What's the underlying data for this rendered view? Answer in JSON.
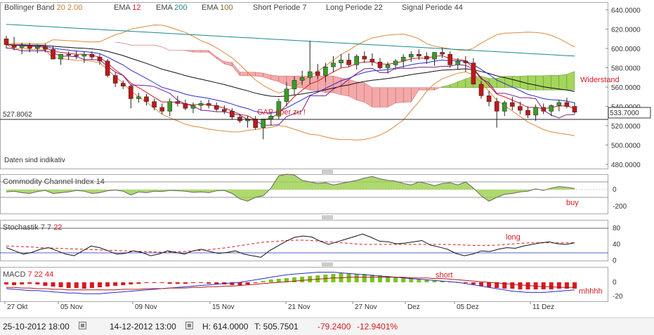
{
  "header": {
    "items": [
      {
        "name": "Bollinger Band",
        "params": "20",
        "params2": "2.00",
        "color": "#c97a2a"
      },
      {
        "name": "EMA",
        "params": "12",
        "color": "#d71920"
      },
      {
        "name": "EMA",
        "params": "200",
        "color": "#1a8a8a"
      },
      {
        "name": "EMA",
        "params": "100",
        "color": "#8a6a2a"
      },
      {
        "name": "Short Periode",
        "params": "7",
        "color": "#444444"
      },
      {
        "name": "Long Periode",
        "params": "22",
        "color": "#444444"
      },
      {
        "name": "Signal Periode",
        "params": "44",
        "color": "#444444"
      }
    ]
  },
  "main": {
    "y_ticks": [
      "640.0000",
      "620.0000",
      "600.0000",
      "580.0000",
      "560.0000",
      "540.0000",
      "520.0000",
      "500.0000",
      "480.0000"
    ],
    "left_marker": "527.8062",
    "last_price": "533.7000",
    "note": "Daten sind indikativ",
    "ann_gap": "GAP aber zu !",
    "ann_widerstand": "Widerstand"
  },
  "cci": {
    "title": "Commodity Channel Index",
    "param": "14",
    "ticks": [
      "0",
      "-200"
    ],
    "ann": "buy"
  },
  "stoch": {
    "title": "Stochastik",
    "p1": "7",
    "p2": "7",
    "p3": "22",
    "ticks": [
      "80",
      "40",
      "0"
    ],
    "ann": "long"
  },
  "macd": {
    "title": "MACD",
    "p1": "7",
    "p2": "22",
    "p3": "44",
    "ticks": [
      "0",
      "-20"
    ],
    "ann_short": "short",
    "ann_mh": "mhhhh"
  },
  "x_labels": [
    "27 Okt",
    "05 Nov",
    "09 Nov",
    "15 Nov",
    "21 Nov",
    "27 Nov",
    "Dez",
    "05 Dez",
    "11 Dez"
  ],
  "footer": {
    "from": "25-10-2012 18:00",
    "to": "14-12-2012 13:00",
    "high": "H: 614.0000",
    "low": "T: 505.7501",
    "change": "-79.2400",
    "change_pct": "-12.9401%"
  },
  "chart_data": {
    "type": "line",
    "ylim": [
      480,
      640
    ],
    "candles": [
      [
        610,
        613,
        600,
        604
      ],
      [
        604,
        612,
        598,
        601
      ],
      [
        601,
        606,
        594,
        603
      ],
      [
        603,
        606,
        596,
        600
      ],
      [
        600,
        604,
        595,
        602
      ],
      [
        602,
        605,
        596,
        599
      ],
      [
        599,
        603,
        590,
        589
      ],
      [
        589,
        594,
        583,
        594
      ],
      [
        594,
        597,
        588,
        593
      ],
      [
        593,
        598,
        589,
        592
      ],
      [
        592,
        597,
        585,
        594
      ],
      [
        594,
        597,
        588,
        591
      ],
      [
        591,
        594,
        583,
        587
      ],
      [
        587,
        589,
        570,
        572
      ],
      [
        572,
        575,
        560,
        564
      ],
      [
        564,
        567,
        558,
        561
      ],
      [
        561,
        563,
        538,
        548
      ],
      [
        548,
        554,
        544,
        550
      ],
      [
        550,
        553,
        541,
        545
      ],
      [
        545,
        548,
        536,
        539
      ],
      [
        539,
        543,
        532,
        535
      ],
      [
        535,
        548,
        530,
        545
      ],
      [
        545,
        551,
        540,
        543
      ],
      [
        543,
        547,
        536,
        538
      ],
      [
        538,
        544,
        533,
        541
      ],
      [
        541,
        546,
        536,
        543
      ],
      [
        543,
        547,
        538,
        541
      ],
      [
        541,
        544,
        535,
        537
      ],
      [
        537,
        541,
        532,
        535
      ],
      [
        535,
        538,
        526,
        529
      ],
      [
        529,
        532,
        523,
        525
      ],
      [
        525,
        530,
        518,
        527
      ],
      [
        527,
        530,
        516,
        518
      ],
      [
        518,
        527,
        506,
        527
      ],
      [
        527,
        534,
        520,
        530
      ],
      [
        530,
        548,
        527,
        545
      ],
      [
        545,
        565,
        540,
        558
      ],
      [
        558,
        571,
        552,
        567
      ],
      [
        567,
        577,
        562,
        570
      ],
      [
        570,
        608,
        563,
        576
      ],
      [
        576,
        584,
        568,
        572
      ],
      [
        572,
        585,
        565,
        581
      ],
      [
        581,
        592,
        575,
        585
      ],
      [
        585,
        594,
        580,
        588
      ],
      [
        588,
        595,
        581,
        583
      ],
      [
        583,
        594,
        578,
        592
      ],
      [
        592,
        597,
        585,
        589
      ],
      [
        589,
        595,
        582,
        586
      ],
      [
        586,
        590,
        578,
        580
      ],
      [
        580,
        586,
        574,
        583
      ],
      [
        583,
        589,
        578,
        587
      ],
      [
        587,
        594,
        580,
        591
      ],
      [
        591,
        597,
        586,
        594
      ],
      [
        594,
        599,
        588,
        592
      ],
      [
        592,
        596,
        584,
        589
      ],
      [
        589,
        594,
        582,
        596
      ],
      [
        596,
        601,
        590,
        594
      ],
      [
        594,
        597,
        580,
        583
      ],
      [
        583,
        590,
        578,
        587
      ],
      [
        587,
        592,
        576,
        585
      ],
      [
        585,
        590,
        568,
        563
      ],
      [
        563,
        566,
        548,
        551
      ],
      [
        551,
        556,
        540,
        545
      ],
      [
        545,
        549,
        518,
        535
      ],
      [
        535,
        546,
        530,
        544
      ],
      [
        544,
        550,
        536,
        540
      ],
      [
        540,
        545,
        532,
        536
      ],
      [
        536,
        540,
        528,
        531
      ],
      [
        531,
        542,
        525,
        539
      ],
      [
        539,
        543,
        532,
        535
      ],
      [
        535,
        542,
        530,
        541
      ],
      [
        541,
        547,
        535,
        544
      ],
      [
        544,
        549,
        538,
        540
      ],
      [
        540,
        544,
        532,
        534
      ]
    ],
    "cci": [
      -30,
      -20,
      -40,
      -50,
      -25,
      -10,
      -50,
      -40,
      -30,
      -10,
      -20,
      -50,
      -40,
      -15,
      -5,
      -20,
      -70,
      -30,
      -40,
      -20,
      -25,
      -10,
      -15,
      -20,
      -35,
      -30,
      -40,
      -15,
      -10,
      -50,
      -120,
      -150,
      -100,
      -80,
      20,
      180,
      200,
      190,
      120,
      100,
      80,
      90,
      60,
      80,
      100,
      120,
      150,
      170,
      140,
      120,
      110,
      80,
      60,
      100,
      80,
      50,
      80,
      90,
      60,
      100,
      20,
      -80,
      -150,
      -100,
      -60,
      -50,
      -30,
      -20,
      10,
      -10,
      20,
      40,
      30,
      15
    ],
    "stoch_k": [
      40,
      30,
      20,
      25,
      35,
      40,
      30,
      20,
      15,
      30,
      45,
      40,
      30,
      20,
      22,
      30,
      25,
      15,
      20,
      30,
      25,
      20,
      30,
      35,
      28,
      22,
      25,
      30,
      20,
      15,
      10,
      30,
      45,
      60,
      72,
      76,
      73,
      60,
      50,
      58,
      66,
      74,
      82,
      72,
      60,
      58,
      52,
      54,
      58,
      62,
      48,
      42,
      35,
      22,
      15,
      20,
      30,
      28,
      35,
      40,
      38,
      45,
      50,
      55,
      58,
      52,
      50,
      55
    ],
    "stoch_d": [
      45,
      44,
      43,
      42,
      40,
      39,
      38,
      37,
      36,
      35,
      34,
      33,
      32,
      31,
      30,
      29,
      28,
      27,
      26,
      26,
      27,
      28,
      30,
      32,
      34,
      37,
      40,
      44,
      48,
      52,
      56,
      58,
      60,
      62,
      63,
      63,
      62,
      60,
      58,
      56,
      54,
      52,
      50,
      50,
      50,
      50,
      50,
      50,
      50,
      50,
      50,
      50,
      50,
      49,
      48,
      47,
      47,
      47,
      48,
      50,
      52,
      54,
      55,
      55,
      55,
      55,
      55,
      55
    ],
    "macd": [
      -3,
      -4,
      -3,
      -2,
      -3,
      -5,
      -6,
      -7,
      -8,
      -8,
      -9,
      -8,
      -7,
      -6,
      -5,
      -4,
      -3,
      -2,
      -1,
      -1,
      -1,
      -2,
      -2,
      -2,
      -1,
      -1,
      -2,
      -3,
      -3,
      -4,
      -4,
      -3,
      -1,
      2,
      4,
      5,
      6,
      7,
      8,
      9,
      10,
      11,
      12,
      13,
      13,
      12,
      12,
      11,
      10,
      9,
      8,
      7,
      6,
      5,
      4,
      3,
      2,
      1,
      0,
      -1,
      -3,
      -5,
      -7,
      -8,
      -9,
      -9,
      -10,
      -10,
      -10,
      -10,
      -10,
      -9,
      -9,
      -9
    ],
    "macd_line": [
      -10,
      -11,
      -12,
      -13,
      -13,
      -14,
      -15,
      -16,
      -17,
      -17,
      -18,
      -18,
      -18,
      -17,
      -16,
      -15,
      -14,
      -13,
      -12,
      -11,
      -10,
      -9,
      -8,
      -7,
      -6,
      -5,
      -4,
      -3,
      -2,
      -1,
      0,
      2,
      4,
      6,
      8,
      10,
      12,
      13,
      14,
      15,
      16,
      16,
      16,
      15,
      14,
      13,
      12,
      11,
      10,
      9,
      8,
      7,
      6,
      5,
      4,
      3,
      2,
      1,
      0,
      -2,
      -4,
      -6,
      -8,
      -10,
      -12,
      -14,
      -15,
      -16,
      -16,
      -16,
      -15,
      -14,
      -13,
      -12
    ],
    "signal_line": [
      -8,
      -8,
      -9,
      -9,
      -10,
      -10,
      -11,
      -11,
      -12,
      -12,
      -12,
      -12,
      -12,
      -12,
      -12,
      -11,
      -11,
      -11,
      -10,
      -10,
      -10,
      -9,
      -9,
      -9,
      -8,
      -8,
      -7,
      -7,
      -6,
      -6,
      -5,
      -4,
      -3,
      -2,
      -1,
      0,
      1,
      2,
      3,
      4,
      5,
      6,
      7,
      7,
      8,
      8,
      8,
      8,
      8,
      8,
      8,
      8,
      7,
      7,
      7,
      6,
      6,
      5,
      4,
      3,
      2,
      1,
      0,
      -1,
      -2,
      -3,
      -4,
      -5,
      -6,
      -7,
      -7,
      -8,
      -8,
      -8
    ]
  }
}
